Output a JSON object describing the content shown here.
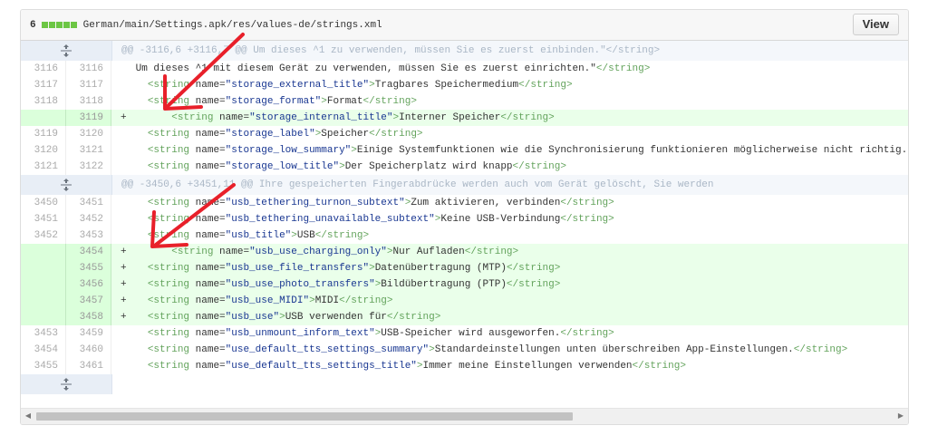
{
  "header": {
    "diff_count": "6",
    "file_path": "German/main/Settings.apk/res/values-de/strings.xml",
    "view_label": "View"
  },
  "colors": {
    "addition_bg": "#eaffea",
    "addition_num_bg": "#dbffdb",
    "hunk_bg": "#f4f7fb",
    "diffstat": "#6cc644",
    "annotation_arrow": "#e8202a"
  },
  "icons": {
    "expand": "unfold-icon"
  },
  "hunks": [
    {
      "header": "@@ -3116,6 +3116,7 @@ Um dieses ^1 zu verwenden, müssen Sie es zuerst einbinden.\"</string>"
    },
    {
      "header": "@@ -3450,6 +3451,11 @@ Ihre gespeicherten Fingerabdrücke werden auch vom Gerät gelöscht, Sie werden"
    }
  ],
  "lines_hunk1": [
    {
      "old": "3116",
      "new": "3116",
      "sign": "",
      "code": " Um dieses ^1 mit diesem Gerät zu verwenden, müssen Sie es zuerst einrichten.\"</string>",
      "added": false
    },
    {
      "old": "3117",
      "new": "3117",
      "sign": "",
      "code": "   <string name=\"storage_external_title\">Tragbares Speichermedium</string>",
      "added": false
    },
    {
      "old": "3118",
      "new": "3118",
      "sign": "",
      "code": "   <string name=\"storage_format\">Format</string>",
      "added": false
    },
    {
      "old": "",
      "new": "3119",
      "sign": "+",
      "code": "       <string name=\"storage_internal_title\">Interner Speicher</string>",
      "added": true
    },
    {
      "old": "3119",
      "new": "3120",
      "sign": "",
      "code": "   <string name=\"storage_label\">Speicher</string>",
      "added": false
    },
    {
      "old": "3120",
      "new": "3121",
      "sign": "",
      "code": "   <string name=\"storage_low_summary\">Einige Systemfunktionen wie die Synchronisierung funktionieren möglicherweise nicht richtig. V",
      "added": false
    },
    {
      "old": "3121",
      "new": "3122",
      "sign": "",
      "code": "   <string name=\"storage_low_title\">Der Speicherplatz wird knapp</string>",
      "added": false
    }
  ],
  "lines_hunk2": [
    {
      "old": "3450",
      "new": "3451",
      "sign": "",
      "code": "   <string name=\"usb_tethering_turnon_subtext\">Zum aktivieren, verbinden</string>",
      "added": false
    },
    {
      "old": "3451",
      "new": "3452",
      "sign": "",
      "code": "   <string name=\"usb_tethering_unavailable_subtext\">Keine USB-Verbindung</string>",
      "added": false
    },
    {
      "old": "3452",
      "new": "3453",
      "sign": "",
      "code": "   <string name=\"usb_title\">USB</string>",
      "added": false
    },
    {
      "old": "",
      "new": "3454",
      "sign": "+",
      "code": "       <string name=\"usb_use_charging_only\">Nur Aufladen</string>",
      "added": true
    },
    {
      "old": "",
      "new": "3455",
      "sign": "+",
      "code": "   <string name=\"usb_use_file_transfers\">Datenübertragung (MTP)</string>",
      "added": true
    },
    {
      "old": "",
      "new": "3456",
      "sign": "+",
      "code": "   <string name=\"usb_use_photo_transfers\">Bildübertragung (PTP)</string>",
      "added": true
    },
    {
      "old": "",
      "new": "3457",
      "sign": "+",
      "code": "   <string name=\"usb_use_MIDI\">MIDI</string>",
      "added": true
    },
    {
      "old": "",
      "new": "3458",
      "sign": "+",
      "code": "   <string name=\"usb_use\">USB verwenden für</string>",
      "added": true
    },
    {
      "old": "3453",
      "new": "3459",
      "sign": "",
      "code": "   <string name=\"usb_unmount_inform_text\">USB-Speicher wird ausgeworfen.</string>",
      "added": false
    },
    {
      "old": "3454",
      "new": "3460",
      "sign": "",
      "code": "   <string name=\"use_default_tts_settings_summary\">Standardeinstellungen unten überschreiben App-Einstellungen.</string>",
      "added": false
    },
    {
      "old": "3455",
      "new": "3461",
      "sign": "",
      "code": "   <string name=\"use_default_tts_settings_title\">Immer meine Einstellungen verwenden</string>",
      "added": false
    }
  ]
}
